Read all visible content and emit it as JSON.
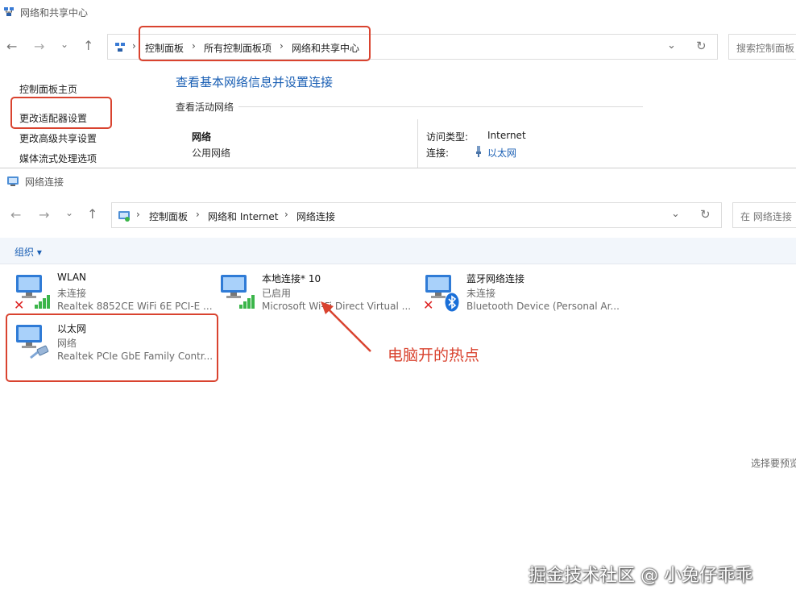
{
  "top_window": {
    "title": "网络和共享中心",
    "breadcrumb": [
      "控制面板",
      "所有控制面板项",
      "网络和共享中心"
    ],
    "search_placeholder": "搜索控制面板",
    "sidebar": [
      "控制面板主页",
      "更改适配器设置",
      "更改高级共享设置",
      "媒体流式处理选项"
    ],
    "heading": "查看基本网络信息并设置连接",
    "section_label": "查看活动网络",
    "network_name": "网络",
    "network_type": "公用网络",
    "access_type_label": "访问类型:",
    "access_type_value": "Internet",
    "connection_label": "连接:",
    "connection_value": "以太网"
  },
  "bottom_window": {
    "title": "网络连接",
    "breadcrumb": [
      "控制面板",
      "网络和 Internet",
      "网络连接"
    ],
    "search_placeholder": "在 网络连接",
    "organize_label": "组织 ▾",
    "adapters": [
      {
        "name": "WLAN",
        "status": "未连接",
        "device": "Realtek 8852CE WiFi 6E PCI-E ..."
      },
      {
        "name": "本地连接* 10",
        "status": "已启用",
        "device": "Microsoft Wi-Fi Direct Virtual ..."
      },
      {
        "name": "蓝牙网络连接",
        "status": "未连接",
        "device": "Bluetooth Device (Personal Ar..."
      },
      {
        "name": "以太网",
        "status": "网络",
        "device": "Realtek PCIe GbE Family Contr..."
      }
    ],
    "preview_hint": "选择要预览"
  },
  "annotation": {
    "text": "电脑开的热点",
    "color": "#d9432f"
  },
  "watermark": "掘金技术社区 @ 小兔仔乖乖",
  "icons": [
    "network-center-icon",
    "back-arrow-icon",
    "forward-arrow-icon",
    "recent-chevron-icon",
    "up-arrow-icon",
    "refresh-icon",
    "monitor-icon",
    "signal-bars-icon",
    "red-x-icon",
    "bluetooth-icon",
    "ethernet-plug-icon",
    "cable-icon"
  ]
}
